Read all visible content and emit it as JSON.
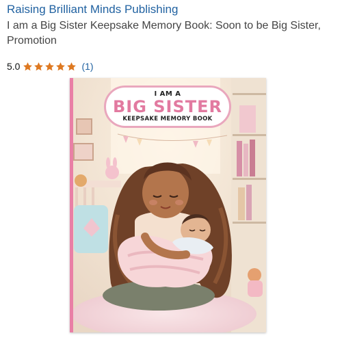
{
  "listing": {
    "author": "Raising Brilliant Minds Publishing",
    "title": "I am a Big Sister Keepsake Memory Book: Soon to be Big Sister, Promotion",
    "rating": {
      "value": "5.0",
      "stars": 5,
      "count": "(1)"
    },
    "cover": {
      "line1": "I AM A",
      "line2": "BIG SISTER",
      "line3": "KEEPSAKE MEMORY BOOK"
    }
  },
  "colors": {
    "link": "#2162a1",
    "star": "#de7921",
    "accent_pink": "#e27aa0"
  },
  "icons": [
    "star-icon"
  ]
}
